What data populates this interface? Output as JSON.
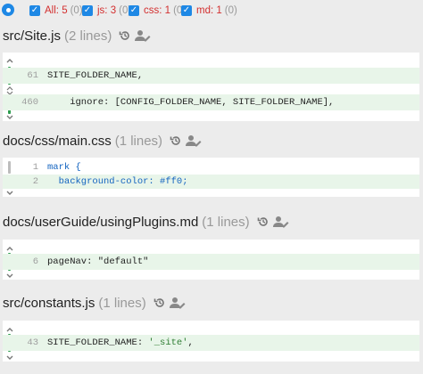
{
  "filters": [
    {
      "name": "All:",
      "value": "5",
      "count": "(0)"
    },
    {
      "name": "js:",
      "value": "3",
      "count": "(0)"
    },
    {
      "name": "css:",
      "value": "1",
      "count": "(0)"
    },
    {
      "name": "md:",
      "value": "1",
      "count": "(0)"
    }
  ],
  "files": [
    {
      "path": "src/Site.js",
      "lines": "(2 lines)",
      "rows": [
        {
          "ln": "61",
          "code": "SITE_FOLDER_NAME,"
        },
        {
          "ln": "460",
          "code": "    ignore: [CONFIG_FOLDER_NAME, SITE_FOLDER_NAME],"
        }
      ]
    },
    {
      "path": "docs/css/main.css",
      "lines": "(1 lines)",
      "rows": [
        {
          "ln": "1",
          "code": "mark {"
        },
        {
          "ln": "2",
          "code": "  background-color: #ff0;"
        }
      ]
    },
    {
      "path": "docs/userGuide/usingPlugins.md",
      "lines": "(1 lines)",
      "rows": [
        {
          "ln": "6",
          "code": "pageNav: \"default\""
        }
      ]
    },
    {
      "path": "src/constants.js",
      "lines": "(1 lines)",
      "rows": [
        {
          "ln": "43",
          "code": "SITE_FOLDER_NAME: '_site',"
        }
      ]
    }
  ]
}
